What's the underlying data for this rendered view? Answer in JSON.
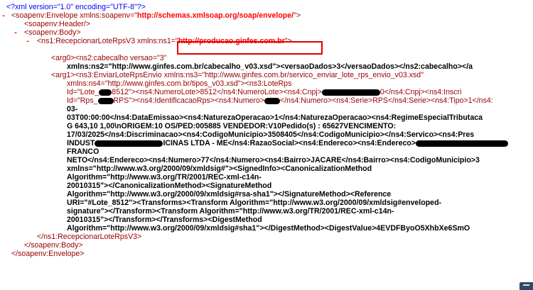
{
  "prolog": "<?xml version=\"1.0\" encoding=\"UTF-8\"?>",
  "toggle_symbol": "-",
  "envelope": {
    "open_prefix": "<soapenv:Envelope xmlns:soapenv=\"",
    "ns_url": "http://schemas.xmlsoap.org/soap/envelope/",
    "open_suffix": "\">",
    "close": "</soapenv:Envelope>"
  },
  "header_tag": "<soapenv:Header/>",
  "body_open": "<soapenv:Body>",
  "body_close": "</soapenv:Body>",
  "recepcionar": {
    "open_prefix": "<ns1:RecepcionarLoteRpsV3 xmlns:ns1=\"",
    "ns_url": "http://producao.ginfes.com.br",
    "open_suffix": "\">",
    "close": "</ns1:RecepcionarLoteRpsV3>"
  },
  "arg0_lines": [
    "<arg0><ns2:cabecalho versao=\"3\"",
    "xmlns:ns2=\"http://www.ginfes.com.br/cabecalho_v03.xsd\"><versaoDados>3</versaoDados></ns2:cabecalho></a"
  ],
  "arg1_lines": {
    "l1": "<arg1><ns3:EnviarLoteRpsEnvio xmlns:ns3=\"http://www.ginfes.com.br/servico_enviar_lote_rps_envio_v03.xsd\"",
    "l2": "xmlns:ns4=\"http://www.ginfes.com.br/tipos_v03.xsd\"><ns3:LoteRps",
    "l3_a": "Id=\"Lote_",
    "l3_b": "8512\"><ns4:NumeroLote>8512</ns4:NumeroLote><ns4:Cnpj>",
    "l3_c": "0</ns4:Cnpj><ns4:Inscri",
    "l4_a": "Id=\"Rps_",
    "l4_b": "RPS\"><ns4:IdentificacaoRps><ns4:Numero>",
    "l4_c": "</ns4:Numero><ns4:Serie>RPS</ns4:Serie><ns4:Tipo>1</ns4:",
    "l5": "03-",
    "l6": "03T00:00:00</ns4:DataEmissao><ns4:NaturezaOperacao>1</ns4:NaturezaOperacao><ns4:RegimeEspecialTributaca",
    "l7": "G 643,10 1,00\\nORIGEM:10 OS/PED:005885 VENDEDOR:V10Pedido(s) : 65627VENCIMENTO:",
    "l8": "17/03/2025</ns4:Discriminacao><ns4:CodigoMunicipio>3508405</ns4:CodigoMunicipio></ns4:Servico><ns4:Pres",
    "l9_a": "INDUST",
    "l9_b": "ICINAS LTDA - ME</ns4:RazaoSocial><ns4:Endereco><ns4:Endereco>",
    "l10": "FRANCO",
    "l11": "NETO</ns4:Endereco><ns4:Numero>77</ns4:Numero><ns4:Bairro>JACARE</ns4:Bairro><ns4:CodigoMunicipio>3",
    "l12": "xmlns=\"http://www.w3.org/2000/09/xmldsig#\"><SignedInfo><CanonicalizationMethod",
    "l13": "Algorithm=\"http://www.w3.org/TR/2001/REC-xml-c14n-",
    "l14": "20010315\"></CanonicalizationMethod><SignatureMethod",
    "l15": "Algorithm=\"http://www.w3.org/2000/09/xmldsig#rsa-sha1\"></SignatureMethod><Reference",
    "l16": "URI=\"#Lote_8512\"><Transforms><Transform Algorithm=\"http://www.w3.org/2000/09/xmldsig#enveloped-",
    "l17": "signature\"></Transform><Transform Algorithm=\"http://www.w3.org/TR/2001/REC-xml-c14n-",
    "l18": "20010315\"></Transform></Transforms><DigestMethod",
    "l19": "Algorithm=\"http://www.w3.org/2000/09/xmldsig#sha1\"></DigestMethod><DigestValue>4EVDFByoO5XhbXe6SmO"
  },
  "colors": {
    "markup": "#0000ff",
    "tag": "#990000",
    "namespace_value": "#ff0000",
    "highlight_border": "#e10000"
  }
}
